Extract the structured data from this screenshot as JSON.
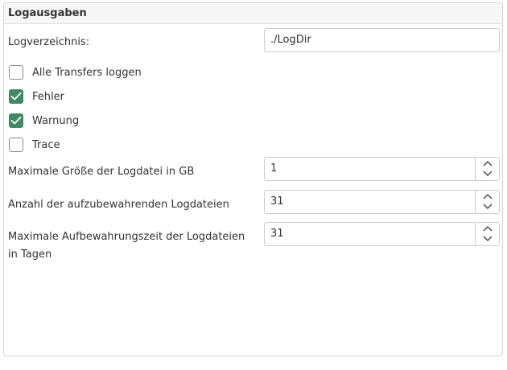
{
  "panel": {
    "title": "Logausgaben"
  },
  "log_directory": {
    "label": "Logverzeichnis:",
    "value": "./LogDir"
  },
  "checkboxes": [
    {
      "label": "Alle Transfers loggen",
      "checked": false
    },
    {
      "label": "Fehler",
      "checked": true
    },
    {
      "label": "Warnung",
      "checked": true
    },
    {
      "label": "Trace",
      "checked": false
    }
  ],
  "max_logfile_size": {
    "label": "Maximale Größe der Logdatei in GB",
    "value": "1"
  },
  "logfile_count": {
    "label": "Anzahl der aufzubewahrenden Logdateien",
    "value": "31"
  },
  "retention_days": {
    "label_line1": "Maximale Aufbewahrungszeit der Logdateien",
    "label_line2": "in Tagen",
    "value": "31"
  },
  "colors": {
    "checked_fill": "#3f8a63",
    "border": "#cccccc",
    "header_bg": "#f7f7f7"
  },
  "icons": {
    "check": "check-icon",
    "spin_up": "chevron-up-icon",
    "spin_down": "chevron-down-icon"
  }
}
